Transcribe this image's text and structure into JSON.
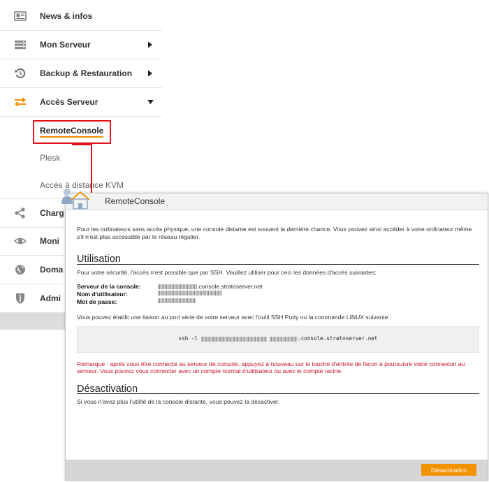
{
  "nav": {
    "items": [
      {
        "label": "News & infos",
        "icon": "newspaper-icon"
      },
      {
        "label": "Mon Serveur",
        "icon": "server-icon"
      },
      {
        "label": "Backup & Restauration",
        "icon": "restore-icon"
      },
      {
        "label": "Accès Serveur",
        "icon": "transfer-arrows-icon"
      }
    ],
    "sub_items": [
      {
        "label": "RemoteConsole"
      },
      {
        "label": "Plesk"
      },
      {
        "label": "Accès à distance KVM"
      }
    ],
    "lower_items": [
      {
        "label": "Charg",
        "icon": "share-icon"
      },
      {
        "label": "Moni",
        "icon": "eye-icon"
      },
      {
        "label": "Doma",
        "icon": "globe-icon"
      },
      {
        "label": "Admi",
        "icon": "shield-icon"
      }
    ],
    "accent_color": "#f39200",
    "highlight_color": "#e2121a"
  },
  "dialog": {
    "title": "RemoteConsole",
    "intro": "Pour les ordinateurs sans accès physique, une console distante est souvent la dernière chance. Vous pouvez ainsi accéder à votre ordinateur même s'il n'est plus accessible par le réseau régulier.",
    "usage": {
      "title": "Utilisation",
      "text": "Pour votre sécurité, l'accès n'est possible que par SSH. Veuillez utiliser pour ceci les données d'accès suivantes:",
      "console_label": "Serveur de la console:",
      "console_suffix": ".console.stratoserver.net",
      "username_label": "Nom d'utilisateur:",
      "password_label": "Mot de passe:",
      "serial_text": "Vous pouvez établir une liaison au port série de votre serveur avec l'outil SSH Putty ou la commande LINUX suivante :",
      "command_prefix": "ssh -l",
      "command_suffix": ".console.stratoserver.net",
      "note": "Remarque : après vous être connecté au serveur de console, appuyez à nouveau sur la touche d'entrée de façon à poursuivre votre connexion au serveur. Vous pouvez vous connecter avec un compte normal d'utilisateur ou avec le compte racine."
    },
    "deactivation": {
      "title": "Désactivation",
      "text": "Si vous n'avez plus l'utilité de la console distante, vous pouvez la désactiver.",
      "button_label": "Désactivation"
    }
  }
}
